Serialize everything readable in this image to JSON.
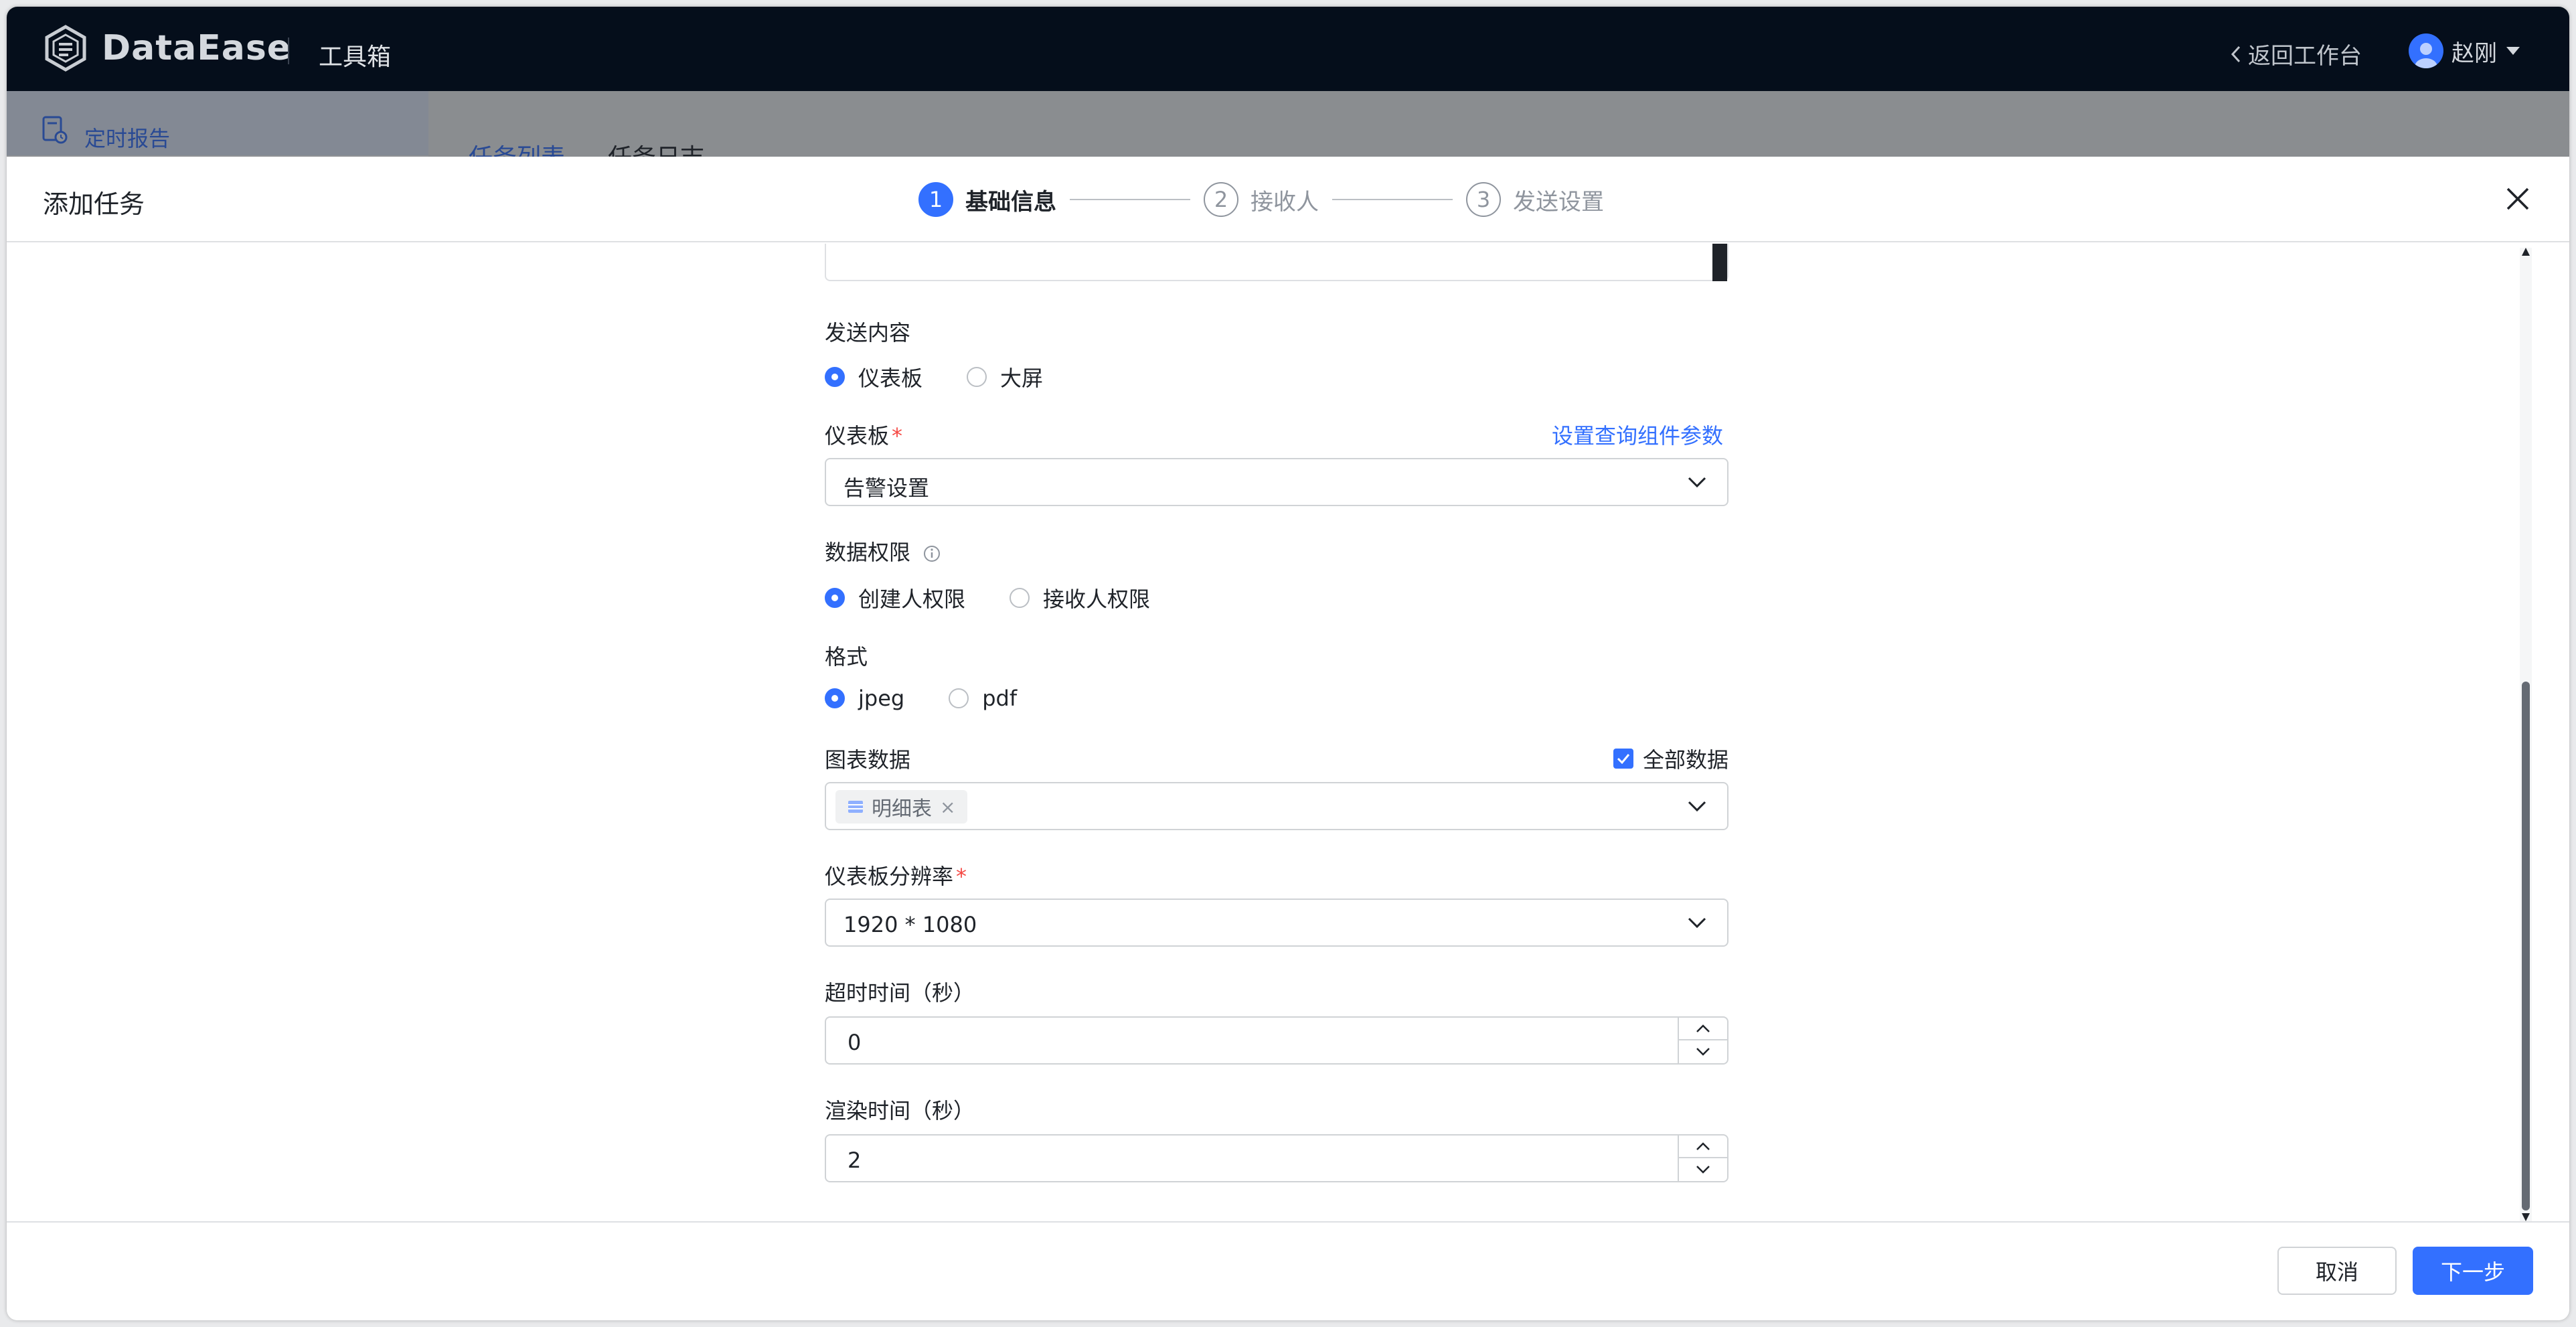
{
  "topbar": {
    "logo_text": "DataEase",
    "toolbox_title": "工具箱",
    "back_link": "返回工作台",
    "user_name": "赵刚"
  },
  "background": {
    "sidebar_item": "定时报告",
    "tabs": [
      "任务列表",
      "任务日志"
    ]
  },
  "drawer": {
    "title": "添加任务",
    "steps": [
      {
        "num": "1",
        "label": "基础信息"
      },
      {
        "num": "2",
        "label": "接收人"
      },
      {
        "num": "3",
        "label": "发送设置"
      }
    ],
    "form": {
      "send_content": {
        "label": "发送内容",
        "options": [
          "仪表板",
          "大屏"
        ],
        "selected": "仪表板"
      },
      "dashboard": {
        "label": "仪表板",
        "required_mark": "*",
        "link": "设置查询组件参数",
        "value": "告警设置"
      },
      "data_permission": {
        "label": "数据权限",
        "options": [
          "创建人权限",
          "接收人权限"
        ],
        "selected": "创建人权限"
      },
      "format": {
        "label": "格式",
        "options": [
          "jpeg",
          "pdf"
        ],
        "selected": "jpeg"
      },
      "chart_data": {
        "label": "图表数据",
        "all_data_label": "全部数据",
        "all_data_checked": true,
        "tags": [
          "明细表"
        ]
      },
      "resolution": {
        "label": "仪表板分辨率",
        "required_mark": "*",
        "value": "1920 * 1080"
      },
      "timeout": {
        "label": "超时时间（秒）",
        "value": "0"
      },
      "render_time": {
        "label": "渲染时间（秒）",
        "value": "2"
      }
    },
    "footer": {
      "cancel_label": "取消",
      "next_label": "下一步"
    }
  },
  "colors": {
    "accent": "#3370ff",
    "topbar_bg": "#050e1b",
    "required": "#f54a45"
  }
}
